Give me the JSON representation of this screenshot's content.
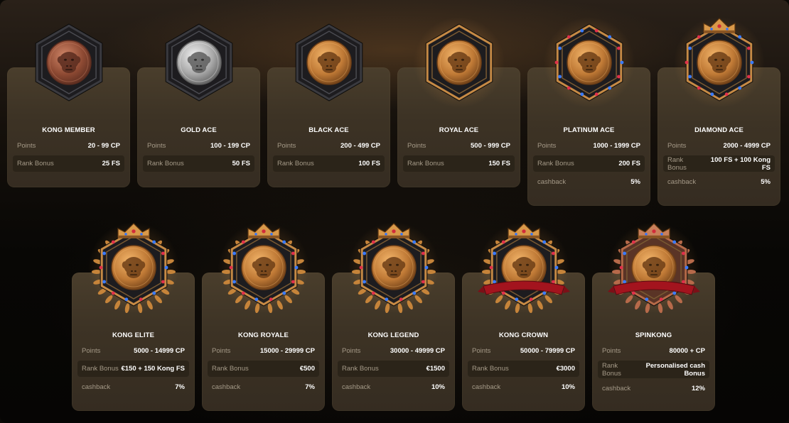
{
  "labels": {
    "points": "Points",
    "rank_bonus": "Rank Bonus",
    "cashback": "cashback",
    "rank": "Rank",
    "bonus": "Bonus"
  },
  "colors": {
    "gold": "#c98a42",
    "bronze": "#b5694a",
    "silver": "#c9c9c9",
    "gem_red": "#e0304a",
    "gem_blue": "#3a7bff",
    "ribbon": "#a3141e"
  },
  "ranks": [
    {
      "name": "KONG MEMBER",
      "points": "20 - 99 CP",
      "rank_bonus": "25 FS",
      "cashback": "",
      "coin": "bronze",
      "icon": "gorilla-coin-icon"
    },
    {
      "name": "GOLD ACE",
      "points": "100 - 199 CP",
      "rank_bonus": "50 FS",
      "cashback": "",
      "coin": "silver",
      "icon": "gorilla-coin-icon"
    },
    {
      "name": "BLACK ACE",
      "points": "200 - 499 CP",
      "rank_bonus": "100 FS",
      "cashback": "",
      "coin": "gold",
      "icon": "gorilla-coin-icon"
    },
    {
      "name": "ROYAL ACE",
      "points": "500 - 999 CP",
      "rank_bonus": "150 FS",
      "cashback": "",
      "coin": "gold",
      "icon": "gorilla-coin-icon"
    },
    {
      "name": "PLATINUM ACE",
      "points": "1000 - 1999 CP",
      "rank_bonus": "200 FS",
      "cashback": "5%",
      "coin": "gold",
      "icon": "gorilla-coin-icon"
    },
    {
      "name": "DIAMOND ACE",
      "points": "2000 - 4999 CP",
      "rank_bonus": "100 FS + 100 Kong FS",
      "cashback": "5%",
      "coin": "gold",
      "icon": "crown-icon"
    },
    {
      "name": "KONG ELITE",
      "points": "5000 - 14999 CP",
      "rank_bonus": "€150 + 150 Kong FS",
      "cashback": "7%",
      "coin": "gold",
      "icon": "crown-laurel-icon"
    },
    {
      "name": "KONG ROYALE",
      "points": "15000 - 29999 CP",
      "rank_bonus": "€500",
      "cashback": "7%",
      "coin": "gold",
      "icon": "crown-laurel-icon"
    },
    {
      "name": "KONG LEGEND",
      "points": "30000 - 49999 CP",
      "rank_bonus": "€1500",
      "cashback": "10%",
      "coin": "gold",
      "icon": "crown-laurel-icon"
    },
    {
      "name": "KONG CROWN",
      "points": "50000 - 79999 CP",
      "rank_bonus": "€3000",
      "cashback": "10%",
      "coin": "gold",
      "icon": "crown-ribbon-icon"
    },
    {
      "name": "SPINKONG",
      "points": "80000 + CP",
      "rank_bonus": "Personalised cash Bonus",
      "cashback": "12%",
      "coin": "gold",
      "icon": "crown-ribbon-icon"
    }
  ]
}
